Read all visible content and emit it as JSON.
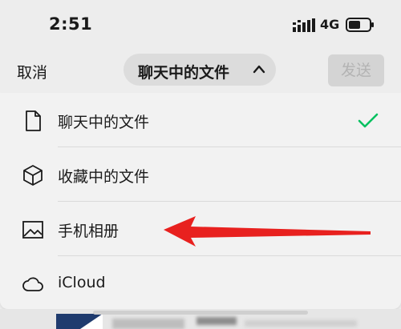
{
  "status_bar": {
    "time": "2:51",
    "network": "4G",
    "signal_icon": "signal-bars-icon",
    "battery_icon": "battery-icon"
  },
  "header": {
    "cancel_label": "取消",
    "title": "聊天中的文件",
    "title_icon": "chevron-up-icon",
    "send_label": "发送"
  },
  "menu": {
    "items": [
      {
        "label": "聊天中的文件",
        "icon": "document-icon",
        "selected": true
      },
      {
        "label": "收藏中的文件",
        "icon": "cube-icon",
        "selected": false
      },
      {
        "label": "手机相册",
        "icon": "image-icon",
        "selected": false
      },
      {
        "label": "iCloud",
        "icon": "cloud-icon",
        "selected": false
      }
    ],
    "selected_icon": "checkmark-icon"
  },
  "colors": {
    "accent_check": "#07c160",
    "annotation_arrow": "#e8211f",
    "background": "#ededed",
    "panel": "#f2f2f2"
  }
}
